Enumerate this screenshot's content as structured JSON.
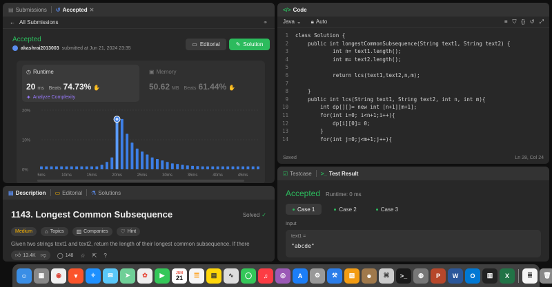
{
  "submission_panel": {
    "tabs": [
      {
        "label": "Submissions"
      },
      {
        "label": "Accepted"
      }
    ],
    "all_submissions": "All Submissions",
    "status": "Accepted",
    "username": "akashrai2013003",
    "submitted_at": "submitted at Jun 21, 2024 23:35",
    "editorial_label": "Editorial",
    "solution_label": "Solution",
    "runtime": {
      "label": "Runtime",
      "value": "20",
      "unit": "ms",
      "beats_label": "Beats",
      "beats": "74.73%",
      "analyze": "Analyze Complexity"
    },
    "memory": {
      "label": "Memory",
      "value": "50.62",
      "unit": "MB",
      "beats_label": "Beats",
      "beats": "61.44%"
    }
  },
  "chart_data": {
    "type": "bar",
    "x_ticks": [
      "5ms",
      "10ms",
      "15ms",
      "20ms",
      "25ms",
      "30ms",
      "35ms",
      "40ms",
      "45ms"
    ],
    "y_ticks": [
      "20%",
      "10%",
      "0%"
    ],
    "ylim": [
      0,
      20
    ],
    "bar_x_ms": [
      5,
      6,
      7,
      8,
      9,
      10,
      11,
      12,
      13,
      14,
      15,
      16,
      17,
      18,
      19,
      20,
      21,
      22,
      23,
      24,
      25,
      26,
      27,
      28,
      29,
      30,
      31,
      32,
      33,
      34,
      35,
      36,
      37,
      38,
      39,
      40,
      41,
      42,
      43,
      44,
      45,
      46,
      47,
      48
    ],
    "values": [
      1,
      1,
      1,
      1,
      1,
      1,
      1,
      1,
      1,
      1,
      1,
      1,
      1.5,
      2.5,
      4,
      16,
      17,
      12,
      9,
      7,
      6,
      5,
      4,
      3.5,
      3,
      2.5,
      2,
      1.8,
      1.5,
      1.3,
      1.2,
      1.1,
      1,
      1,
      1,
      1,
      1,
      1,
      1,
      1,
      1,
      1,
      1,
      1
    ],
    "highlight_x": 20
  },
  "code_panel": {
    "tab": "Code",
    "language": "Java",
    "mode": "Auto",
    "lines": [
      {
        "n": "1",
        "t": "class Solution {"
      },
      {
        "n": "2",
        "t": "    public int longestCommonSubsequence(String text1, String text2) {"
      },
      {
        "n": "3",
        "t": "            int n= text1.length();"
      },
      {
        "n": "4",
        "t": "            int m= text2.length();"
      },
      {
        "n": "5",
        "t": ""
      },
      {
        "n": "6",
        "t": "            return lcs(text1,text2,n,m);"
      },
      {
        "n": "7",
        "t": ""
      },
      {
        "n": "8",
        "t": "    }"
      },
      {
        "n": "9",
        "t": "    public int lcs(String text1, String text2, int n, int m){"
      },
      {
        "n": "10",
        "t": "        int dp[][]= new int [n+1][m+1];"
      },
      {
        "n": "11",
        "t": "        for(int i=0; i<n+1;i++){"
      },
      {
        "n": "12",
        "t": "            dp[i][0]= 0;"
      },
      {
        "n": "13",
        "t": "        }"
      },
      {
        "n": "14",
        "t": "        for(int j=0;j<m+1;j++){"
      }
    ],
    "saved": "Saved",
    "cursor": "Ln 28, Col 24"
  },
  "test_panel": {
    "tabs": [
      {
        "label": "Testcase"
      },
      {
        "label": "Test Result"
      }
    ],
    "status": "Accepted",
    "runtime": "Runtime: 0 ms",
    "cases": [
      {
        "label": "Case 1"
      },
      {
        "label": "Case 2"
      },
      {
        "label": "Case 3"
      }
    ],
    "input_label": "Input",
    "var_name": "text1 =",
    "var_value": "\"abcde\""
  },
  "description_panel": {
    "tabs": [
      {
        "label": "Description"
      },
      {
        "label": "Editorial"
      },
      {
        "label": "Solutions"
      }
    ],
    "title": "1143. Longest Common Subsequence",
    "solved": "Solved",
    "tags": [
      {
        "label": "Medium"
      },
      {
        "label": "Topics"
      },
      {
        "label": "Companies"
      },
      {
        "label": "Hint"
      }
    ],
    "text": "Given two strings text1 and text2, return the length of their longest common subsequence. If there",
    "likes": "13.4K",
    "comments": "148"
  },
  "dock": {
    "calendar_month": "JUN",
    "calendar_day": "21"
  },
  "colors": {
    "accent_green": "#2cbb5d",
    "bar_blue": "#3d7fe6",
    "medium_yellow": "#ffb800"
  }
}
